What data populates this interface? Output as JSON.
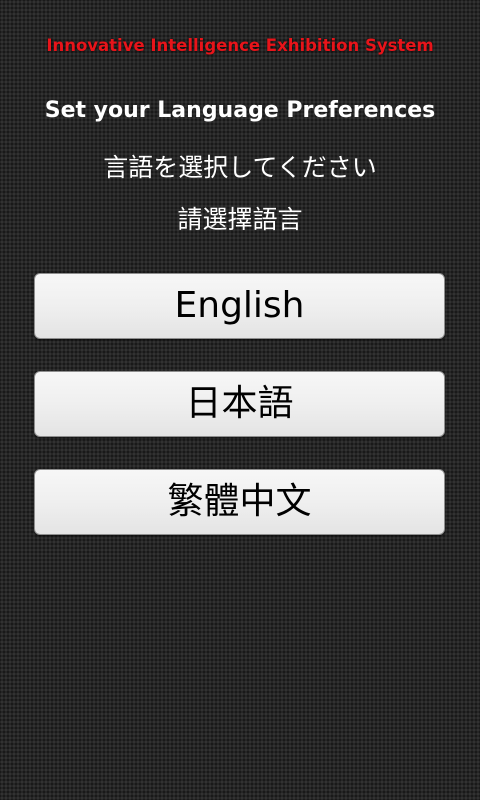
{
  "header": {
    "app_title": "Innovative Intelligence Exhibition System"
  },
  "prompts": {
    "english": "Set your Language Preferences",
    "japanese": "言語を選択してください",
    "chinese": "請選擇語言"
  },
  "language_buttons": [
    {
      "label": "English"
    },
    {
      "label": "日本語"
    },
    {
      "label": "繁體中文"
    }
  ],
  "colors": {
    "title": "#e8141a",
    "background": "#262626",
    "button_bg": "#efefef",
    "text": "#ffffff"
  }
}
